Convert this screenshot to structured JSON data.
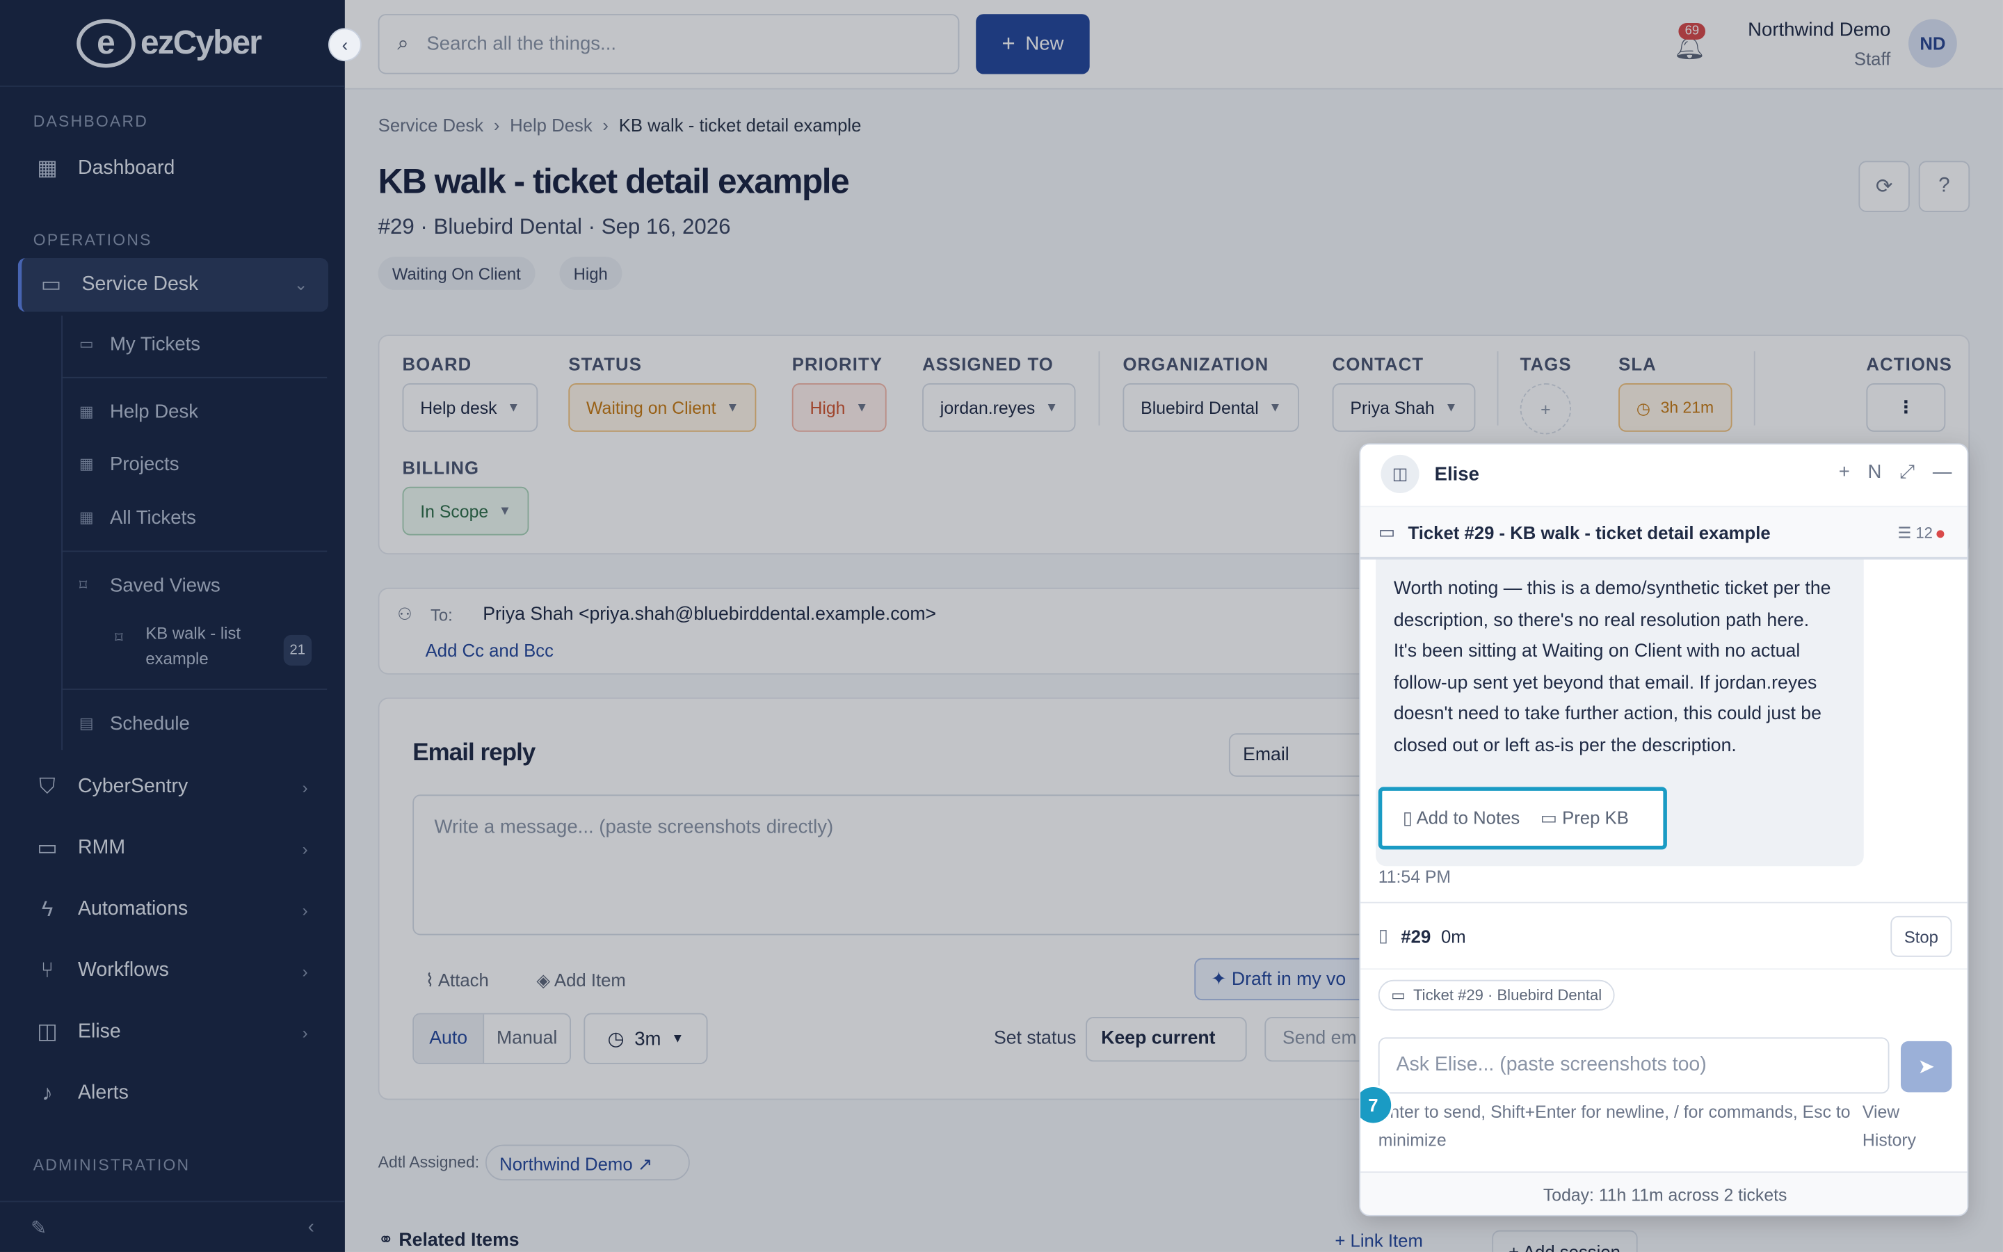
{
  "brand": {
    "logo_letter": "e",
    "name": "ezCyber"
  },
  "sidebar": {
    "sections": [
      "DASHBOARD",
      "OPERATIONS",
      "ADMINISTRATION"
    ],
    "dashboard": "Dashboard",
    "service_desk": "Service Desk",
    "sub_items": [
      "My Tickets",
      "Help Desk",
      "Projects",
      "All Tickets",
      "Saved Views",
      "Schedule"
    ],
    "saved_view": "KB walk - list example",
    "saved_view_count": "21",
    "groups": [
      "CyberSentry",
      "RMM",
      "Automations",
      "Workflows",
      "Elise",
      "Alerts"
    ]
  },
  "topbar": {
    "search_placeholder": "Search all the things...",
    "new_label": "New",
    "notifications": "69",
    "user_name": "Northwind Demo",
    "user_role": "Staff",
    "avatar": "ND"
  },
  "ticket": {
    "breadcrumb": [
      "Service Desk",
      "Help Desk",
      "KB walk - ticket detail example"
    ],
    "title": "KB walk - ticket detail example",
    "subtitle": "#29 · Bluebird Dental · Sep 16, 2026",
    "chips": [
      "Waiting On Client",
      "High"
    ]
  },
  "fields": {
    "labels": [
      "BOARD",
      "STATUS",
      "PRIORITY",
      "ASSIGNED TO",
      "ORGANIZATION",
      "CONTACT",
      "TAGS",
      "SLA",
      "ACTIONS",
      "BILLING"
    ],
    "board": "Help desk",
    "status": "Waiting on Client",
    "priority": "High",
    "assigned": "jordan.reyes",
    "organization": "Bluebird Dental",
    "contact": "Priya Shah",
    "sla": "3h 21m",
    "billing": "In Scope"
  },
  "email": {
    "to_label": "To:",
    "to_value": "Priya Shah <priya.shah@bluebirddental.example.com>",
    "add_cc": "Add Cc and Bcc",
    "reply_title": "Email reply",
    "channel": "Email",
    "placeholder": "Write a message... (paste screenshots directly)",
    "attach": "Attach",
    "add_item": "Add Item",
    "draft": "Draft in my vo",
    "mode_auto": "Auto",
    "mode_manual": "Manual",
    "delay": "3m",
    "set_status_label": "Set status",
    "set_status_value": "Keep current",
    "send": "Send em"
  },
  "footer": {
    "adtl_label": "Adtl Assigned:",
    "adtl_value": "Northwind Demo ↗",
    "related": "Related Items",
    "link_item": "Link Item",
    "add_session": "Add session"
  },
  "elise": {
    "name": "Elise",
    "tool_n": "N",
    "conversation": "Ticket #29 - KB walk - ticket detail example",
    "msg_count": "12",
    "message": "Worth noting — this is a demo/synthetic ticket per the description, so there's no real resolution path here. It's been sitting at Waiting on Client with no actual follow-up sent yet beyond that email. If jordan.reyes doesn't need to take further action, this could just be closed out or left as-is per the description.",
    "add_to_notes": "Add to Notes",
    "prep_kb": "Prep KB",
    "step": "7",
    "time": "11:54 PM",
    "timer_ticket": "#29",
    "timer_value": "0m",
    "stop": "Stop",
    "context_chip": "Ticket #29 · Bluebird Dental",
    "input_placeholder": "Ask Elise... (paste screenshots too)",
    "hint": "Enter to send, Shift+Enter for newline, / for commands, Esc to minimize",
    "view_history": "View History",
    "today": "Today: 11h 11m across 2 tickets"
  },
  "colors": {
    "sidebar_bg": "#1a2744",
    "primary": "#24479b",
    "highlight": "#1a9bc4",
    "status_amber": "#f3a13a",
    "priority_red": "#e46a4c",
    "billing_green": "#4f9a6a"
  }
}
